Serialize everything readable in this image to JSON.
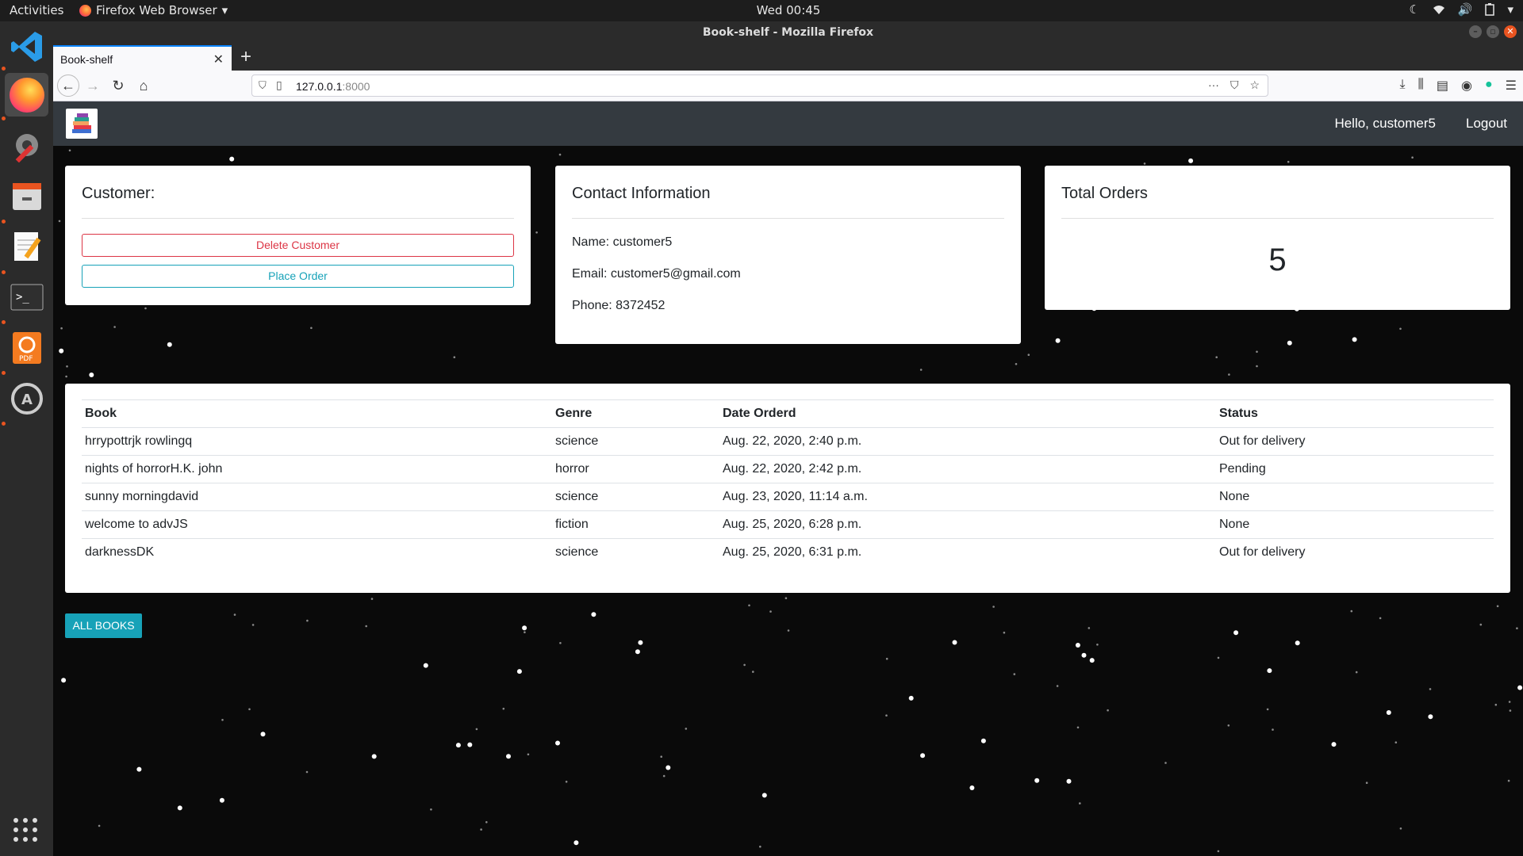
{
  "system_bar": {
    "activities": "Activities",
    "app_name": "Firefox Web Browser",
    "clock": "Wed 00:45"
  },
  "window": {
    "title": "Book-shelf - Mozilla Firefox"
  },
  "browser": {
    "tab_title": "Book-shelf",
    "url_host": "127.0.0.1",
    "url_port": ":8000"
  },
  "site_nav": {
    "greeting": "Hello, customer5",
    "logout": "Logout"
  },
  "customer_card": {
    "title": "Customer:",
    "delete_label": "Delete Customer",
    "place_order_label": "Place Order"
  },
  "contact_card": {
    "title": "Contact Information",
    "name": "Name: customer5",
    "email": "Email: customer5@gmail.com",
    "phone": "Phone: 8372452"
  },
  "orders_card": {
    "title": "Total Orders",
    "count": "5"
  },
  "orders_table": {
    "headers": [
      "Book",
      "Genre",
      "Date Orderd",
      "Status"
    ],
    "rows": [
      [
        "hrrypottrjk rowlingq",
        "science",
        "Aug. 22, 2020, 2:40 p.m.",
        "Out for delivery"
      ],
      [
        "nights of horrorH.K. john",
        "horror",
        "Aug. 22, 2020, 2:42 p.m.",
        "Pending"
      ],
      [
        "sunny morningdavid",
        "science",
        "Aug. 23, 2020, 11:14 a.m.",
        "None"
      ],
      [
        "welcome to advJS",
        "fiction",
        "Aug. 25, 2020, 6:28 p.m.",
        "None"
      ],
      [
        "darknessDK",
        "science",
        "Aug. 25, 2020, 6:31 p.m.",
        "Out for delivery"
      ]
    ]
  },
  "all_books_label": "ALL BOOKS",
  "colors": {
    "navbar": "#343a40",
    "danger": "#dc3545",
    "info": "#17a2b8",
    "page_bg": "#0a0a0a"
  }
}
